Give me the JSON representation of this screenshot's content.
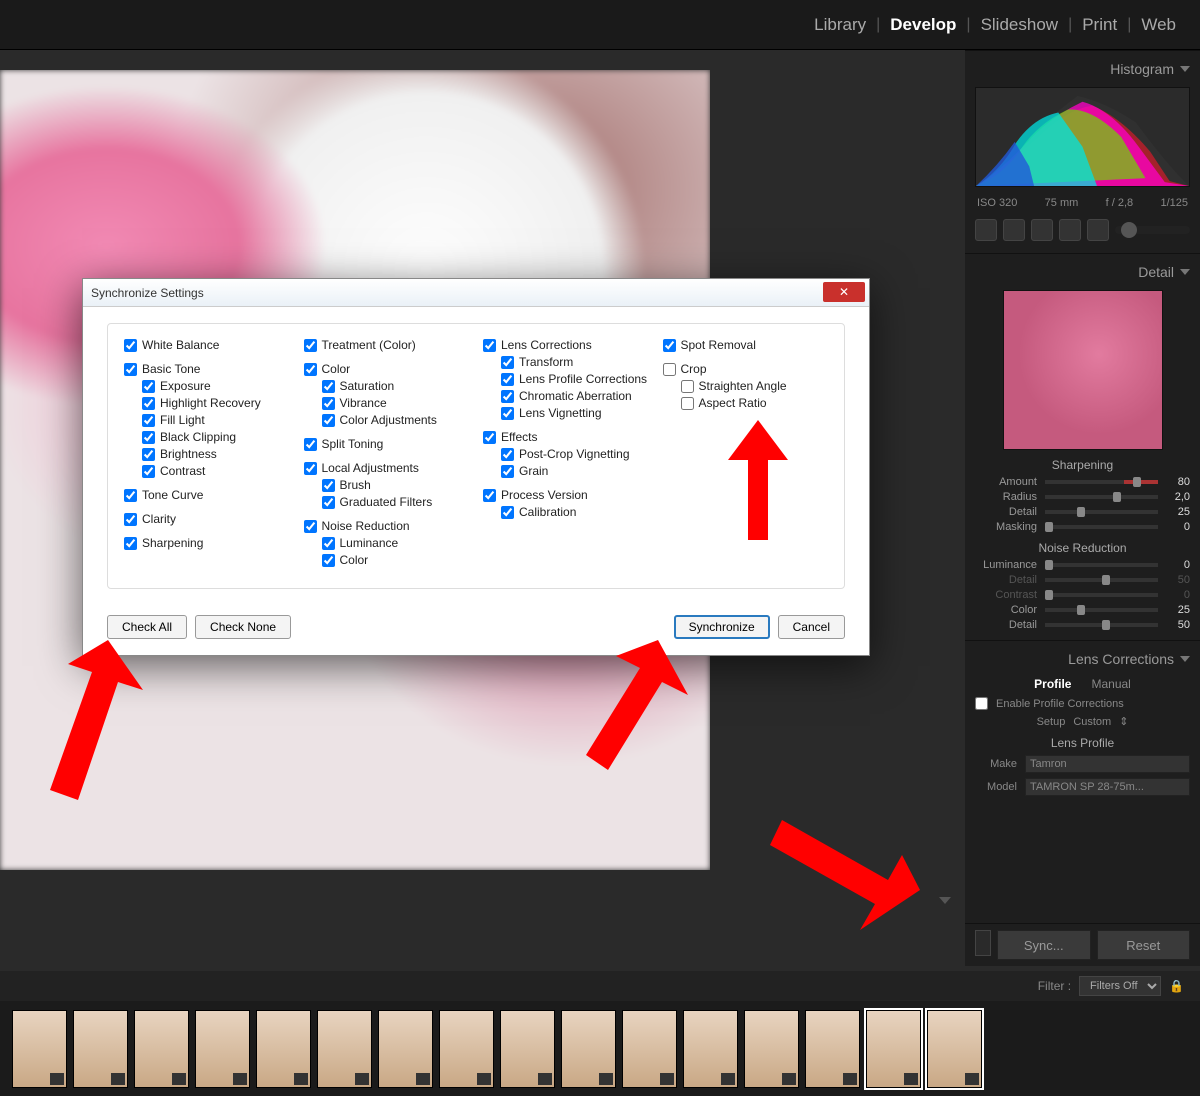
{
  "topbar": {
    "modules": [
      "Library",
      "Develop",
      "Slideshow",
      "Print",
      "Web"
    ],
    "active": "Develop"
  },
  "histogram": {
    "title": "Histogram",
    "iso": "ISO 320",
    "focal": "75 mm",
    "aperture": "f / 2,8",
    "shutter": "1/125"
  },
  "detail": {
    "title": "Detail",
    "sharpening_label": "Sharpening",
    "noise_label": "Noise Reduction",
    "sliders_sharp": [
      {
        "label": "Amount",
        "value": "80",
        "pos": 78,
        "orange": true
      },
      {
        "label": "Radius",
        "value": "2,0",
        "pos": 60
      },
      {
        "label": "Detail",
        "value": "25",
        "pos": 28
      },
      {
        "label": "Masking",
        "value": "0",
        "pos": 0
      }
    ],
    "sliders_noise": [
      {
        "label": "Luminance",
        "value": "0",
        "pos": 0
      },
      {
        "label": "Detail",
        "value": "50",
        "pos": 50,
        "dim": true
      },
      {
        "label": "Contrast",
        "value": "0",
        "pos": 0,
        "dim": true
      },
      {
        "label": "Color",
        "value": "25",
        "pos": 28
      },
      {
        "label": "Detail",
        "value": "50",
        "pos": 50
      }
    ]
  },
  "lens": {
    "title": "Lens Corrections",
    "tab_profile": "Profile",
    "tab_manual": "Manual",
    "enable_label": "Enable Profile Corrections",
    "setup_label": "Setup",
    "setup_value": "Custom",
    "section_label": "Lens Profile",
    "make_label": "Make",
    "make_value": "Tamron",
    "model_label": "Model",
    "model_value": "TAMRON SP 28-75m..."
  },
  "footer_buttons": {
    "sync": "Sync...",
    "reset": "Reset"
  },
  "filter": {
    "label": "Filter :",
    "value": "Filters Off"
  },
  "dialog": {
    "title": "Synchronize Settings",
    "check_all": "Check All",
    "check_none": "Check None",
    "synchronize": "Synchronize",
    "cancel": "Cancel",
    "col1": [
      {
        "label": "White Balance",
        "checked": true,
        "group": true,
        "first": true
      },
      {
        "label": "Basic Tone",
        "checked": true,
        "group": true
      },
      {
        "label": "Exposure",
        "checked": true,
        "indent": true
      },
      {
        "label": "Highlight Recovery",
        "checked": true,
        "indent": true
      },
      {
        "label": "Fill Light",
        "checked": true,
        "indent": true
      },
      {
        "label": "Black Clipping",
        "checked": true,
        "indent": true
      },
      {
        "label": "Brightness",
        "checked": true,
        "indent": true
      },
      {
        "label": "Contrast",
        "checked": true,
        "indent": true
      },
      {
        "label": "Tone Curve",
        "checked": true,
        "group": true
      },
      {
        "label": "Clarity",
        "checked": true,
        "group": true
      },
      {
        "label": "Sharpening",
        "checked": true,
        "group": true
      }
    ],
    "col2": [
      {
        "label": "Treatment (Color)",
        "checked": true,
        "group": true,
        "first": true
      },
      {
        "label": "Color",
        "checked": true,
        "group": true
      },
      {
        "label": "Saturation",
        "checked": true,
        "indent": true
      },
      {
        "label": "Vibrance",
        "checked": true,
        "indent": true
      },
      {
        "label": "Color Adjustments",
        "checked": true,
        "indent": true
      },
      {
        "label": "Split Toning",
        "checked": true,
        "group": true
      },
      {
        "label": "Local Adjustments",
        "checked": true,
        "group": true
      },
      {
        "label": "Brush",
        "checked": true,
        "indent": true
      },
      {
        "label": "Graduated Filters",
        "checked": true,
        "indent": true
      },
      {
        "label": "Noise Reduction",
        "checked": true,
        "group": true
      },
      {
        "label": "Luminance",
        "checked": true,
        "indent": true
      },
      {
        "label": "Color",
        "checked": true,
        "indent": true
      }
    ],
    "col3": [
      {
        "label": "Lens Corrections",
        "checked": true,
        "group": true,
        "first": true
      },
      {
        "label": "Transform",
        "checked": true,
        "indent": true
      },
      {
        "label": "Lens Profile Corrections",
        "checked": true,
        "indent": true
      },
      {
        "label": "Chromatic Aberration",
        "checked": true,
        "indent": true
      },
      {
        "label": "Lens Vignetting",
        "checked": true,
        "indent": true
      },
      {
        "label": "Effects",
        "checked": true,
        "group": true
      },
      {
        "label": "Post-Crop Vignetting",
        "checked": true,
        "indent": true
      },
      {
        "label": "Grain",
        "checked": true,
        "indent": true
      },
      {
        "label": "Process Version",
        "checked": true,
        "group": true
      },
      {
        "label": "Calibration",
        "checked": true,
        "indent": true
      }
    ],
    "col4": [
      {
        "label": "Spot Removal",
        "checked": true,
        "group": true,
        "first": true
      },
      {
        "label": "Crop",
        "checked": false,
        "group": true
      },
      {
        "label": "Straighten Angle",
        "checked": false,
        "indent": true
      },
      {
        "label": "Aspect Ratio",
        "checked": false,
        "indent": true
      }
    ]
  }
}
